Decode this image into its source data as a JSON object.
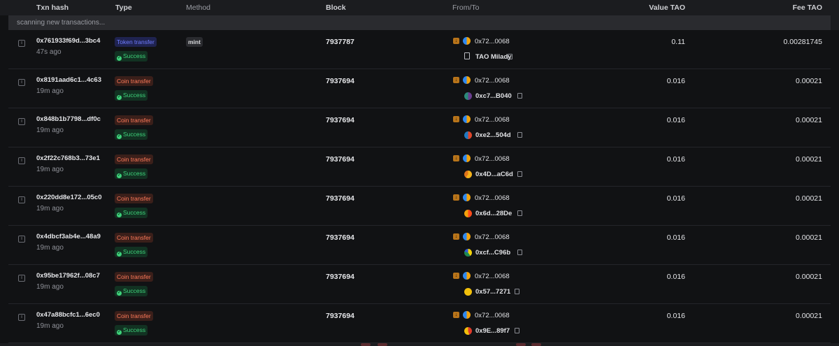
{
  "columns": {
    "txn_hash": "Txn hash",
    "type": "Type",
    "method": "Method",
    "block": "Block",
    "from_to": "From/To",
    "value": "Value TAO",
    "fee": "Fee TAO"
  },
  "banner": "scanning new transactions...",
  "colors": {
    "token_transfer": "#6f7cff",
    "coin_transfer": "#ff7a5a",
    "success": "#3ed27a",
    "direction_icon": "#b8741a"
  },
  "rows": [
    {
      "hash": "0x761933f69d...3bc4",
      "age": "47s ago",
      "type": "Token transfer",
      "status": "Success",
      "method": "mint",
      "block": "7937787",
      "from": "0x72...0068",
      "to": "TAO Milady",
      "value": "0.11",
      "fee": "0.00281745"
    },
    {
      "hash": "0x8191aad6c1...4c63",
      "age": "19m ago",
      "type": "Coin transfer",
      "status": "Success",
      "method": "",
      "block": "7937694",
      "from": "0x72...0068",
      "to": "0xc7...B040",
      "value": "0.016",
      "fee": "0.00021"
    },
    {
      "hash": "0x848b1b7798...df0c",
      "age": "19m ago",
      "type": "Coin transfer",
      "status": "Success",
      "method": "",
      "block": "7937694",
      "from": "0x72...0068",
      "to": "0xe2...504d",
      "value": "0.016",
      "fee": "0.00021"
    },
    {
      "hash": "0x2f22c768b3...73e1",
      "age": "19m ago",
      "type": "Coin transfer",
      "status": "Success",
      "method": "",
      "block": "7937694",
      "from": "0x72...0068",
      "to": "0x4D...aC6d",
      "value": "0.016",
      "fee": "0.00021"
    },
    {
      "hash": "0x220dd8e172...05c0",
      "age": "19m ago",
      "type": "Coin transfer",
      "status": "Success",
      "method": "",
      "block": "7937694",
      "from": "0x72...0068",
      "to": "0x6d...28De",
      "value": "0.016",
      "fee": "0.00021"
    },
    {
      "hash": "0x4dbcf3ab4e...48a9",
      "age": "19m ago",
      "type": "Coin transfer",
      "status": "Success",
      "method": "",
      "block": "7937694",
      "from": "0x72...0068",
      "to": "0xcf...C96b",
      "value": "0.016",
      "fee": "0.00021"
    },
    {
      "hash": "0x95be17962f...08c7",
      "age": "19m ago",
      "type": "Coin transfer",
      "status": "Success",
      "method": "",
      "block": "7937694",
      "from": "0x72...0068",
      "to": "0x57...7271",
      "value": "0.016",
      "fee": "0.00021"
    },
    {
      "hash": "0x47a88bcfc1...6ec0",
      "age": "19m ago",
      "type": "Coin transfer",
      "status": "Success",
      "method": "",
      "block": "7937694",
      "from": "0x72...0068",
      "to": "0x9E...89f7",
      "value": "0.016",
      "fee": "0.00021"
    }
  ]
}
